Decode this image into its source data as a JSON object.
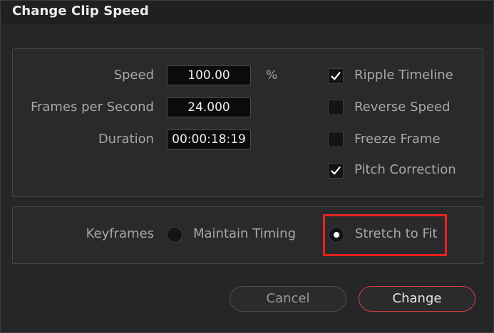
{
  "dialog": {
    "title": "Change Clip Speed"
  },
  "speed": {
    "label": "Speed",
    "value": "100.00",
    "unit": "%"
  },
  "fps": {
    "label": "Frames per Second",
    "value": "24.000"
  },
  "duration": {
    "label": "Duration",
    "value": "00:00:18:19"
  },
  "options": {
    "ripple_timeline": {
      "label": "Ripple Timeline",
      "checked": true
    },
    "reverse_speed": {
      "label": "Reverse Speed",
      "checked": false
    },
    "freeze_frame": {
      "label": "Freeze Frame",
      "checked": false
    },
    "pitch_correction": {
      "label": "Pitch Correction",
      "checked": true
    }
  },
  "keyframes": {
    "label": "Keyframes",
    "maintain_timing": {
      "label": "Maintain Timing",
      "selected": false
    },
    "stretch_to_fit": {
      "label": "Stretch to Fit",
      "selected": true
    }
  },
  "buttons": {
    "cancel": "Cancel",
    "change": "Change"
  },
  "colors": {
    "accent": "#d9423a",
    "highlight": "#e8231e"
  }
}
